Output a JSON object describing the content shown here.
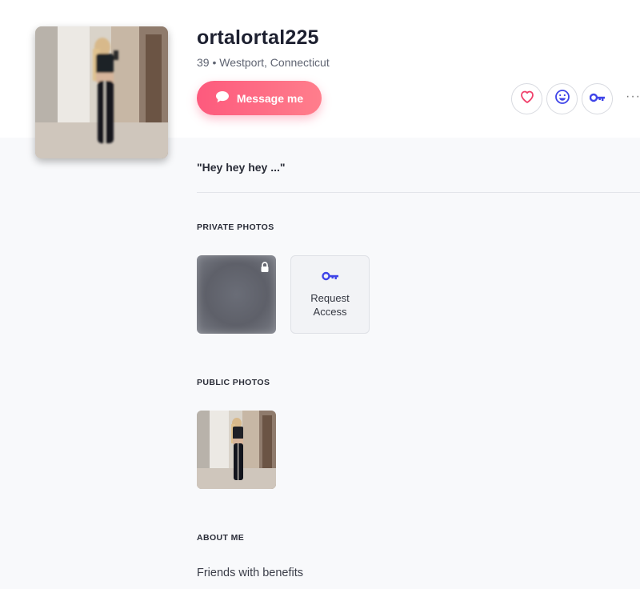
{
  "profile": {
    "username": "ortalortal225",
    "age_location": "39 • Westport, Connecticut",
    "quote": "\"Hey hey hey ...\""
  },
  "actions": {
    "message_label": "Message me",
    "more_label": "···",
    "icons": [
      "heart-icon",
      "smile-icon",
      "key-icon"
    ]
  },
  "sections": {
    "private_photos_title": "PRIVATE PHOTOS",
    "request_access_label": "Request Access",
    "public_photos_title": "PUBLIC PHOTOS",
    "about_title": "ABOUT ME",
    "about_text": "Friends with benefits"
  },
  "colors": {
    "accent_pink": "#fd5a7d",
    "accent_blue": "#3f44e8",
    "background": "#f8f9fb"
  }
}
